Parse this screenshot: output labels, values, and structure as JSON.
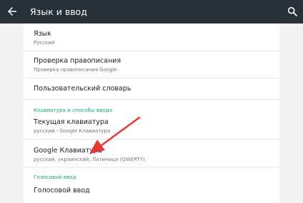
{
  "appbar": {
    "title": "Язык и ввод",
    "back_icon": "arrow-back-icon",
    "search_icon": "search-icon",
    "background": "#263238"
  },
  "items": [
    {
      "title": "Язык",
      "summary": "Русский"
    },
    {
      "title": "Проверка правописания",
      "summary": "Проверка правописания Google"
    },
    {
      "title": "Пользовательский словарь"
    },
    {
      "title": "Текущая клавиатура",
      "summary": "русский - Google Клавиатура"
    },
    {
      "title": "Google Клавиатура",
      "summary": "русский, украинский, Латиница (QWERTY)"
    },
    {
      "title": "Голосовой ввод"
    }
  ],
  "sections": {
    "keyboard": "Клавиатура и способы ввода",
    "voice": "Голосовой ввод"
  },
  "colors": {
    "accent": "#17a08c",
    "annotation_arrow": "#e53935"
  }
}
